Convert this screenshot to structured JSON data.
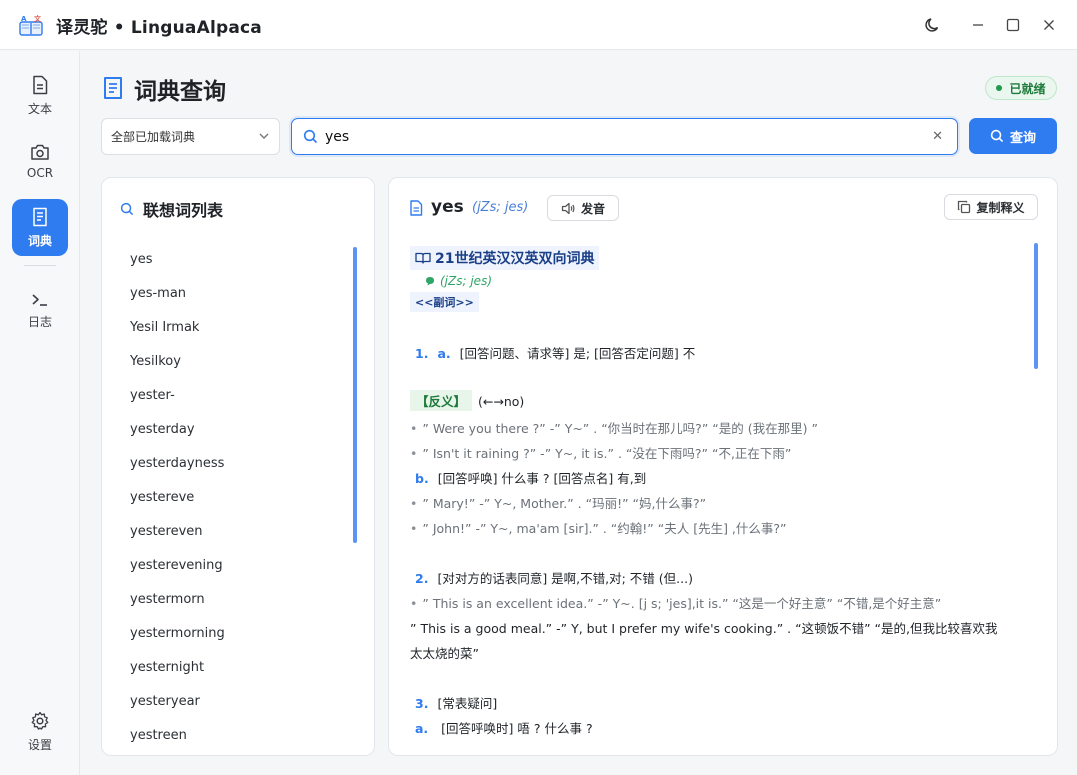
{
  "app": {
    "title": "译灵驼 • LinguaAlpaca"
  },
  "window": {
    "theme_icon": "moon-icon",
    "minimize_icon": "minimize-icon",
    "maximize_icon": "maximize-icon",
    "close_icon": "close-icon"
  },
  "sidebar": {
    "items": [
      {
        "label": "文本",
        "icon": "document-icon"
      },
      {
        "label": "OCR",
        "icon": "camera-icon"
      },
      {
        "label": "词典",
        "icon": "book-icon",
        "active": true
      },
      {
        "label": "日志",
        "icon": "terminal-icon"
      }
    ],
    "settings_label": "设置"
  },
  "header": {
    "title": "词典查询",
    "status": "已就绪"
  },
  "search": {
    "dictionary_select": "全部已加载词典",
    "query": "yes",
    "button_label": "查询"
  },
  "suggestions": {
    "title": "联想词列表",
    "words": [
      "yes",
      "yes-man",
      "Yesil Irmak",
      "Yesilkoy",
      "yester-",
      "yesterday",
      "yesterdayness",
      "yestereve",
      "yestereven",
      "yesterevening",
      "yestermorn",
      "yestermorning",
      "yesternight",
      "yesteryear",
      "yestreen"
    ]
  },
  "entry": {
    "word": "yes",
    "phonetic": "(jZs; jes)",
    "pronounce_label": "发音",
    "copy_label": "复制释义",
    "dictionary_name": "21世纪英汉汉英双向词典",
    "dict_phonetic": "(jZs; jes)",
    "pos": "<<副词>>",
    "lines": {
      "s1a_num": "1.",
      "s1a_sub": "a.",
      "s1a_text": "[回答问题、请求等] 是;  [回答否定问题] 不",
      "antonym_tag": "【反义】",
      "antonym_text": "(←→no)",
      "ex1": "”  Were you there ?”  -”  Y~”  .  “你当时在那儿吗?”  “是的 (我在那里) ”",
      "ex2": "”  Isn't it raining ?”  -”  Y~, it is.”  .  “没在下雨吗?”  “不,正在下雨”",
      "s1b_sub": "b.",
      "s1b_text": "[回答呼唤] 什么事 ? [回答点名] 有,到",
      "ex3": "”  Mary!”  -”  Y~, Mother.”  .  “玛丽!”  “妈,什么事?”",
      "ex4": "”  John!”  -”  Y~, ma'am [sir].”  .  “约翰!”  “夫人 [先生] ,什么事?”",
      "s2_num": "2.",
      "s2_text": "[对对方的话表同意] 是啊,不错,对; 不错 (但...)",
      "ex5": "”  This is an excellent idea.”  -”  Y~. [j  s; 'jes],it is.”  “这是一个好主意”  “不错,是个好主意”",
      "ex6_a": "”  This is a good meal.”  -”  Y, but I prefer my wife's cooking.”  .  “这顿饭不错”  “是的,但我比较喜欢我",
      "ex6_b": "太太烧的菜”",
      "s3_num": "3.",
      "s3_text": "[常表疑问]",
      "s3a_sub": "a.",
      "s3a_text": " [回答呼唤时] 唔 ? 什么事 ?"
    }
  },
  "colors": {
    "accent": "#2f7bf0",
    "status_green": "#1d7a3a",
    "dict_title": "#1a3f87",
    "phonetic_green": "#2fa566"
  }
}
